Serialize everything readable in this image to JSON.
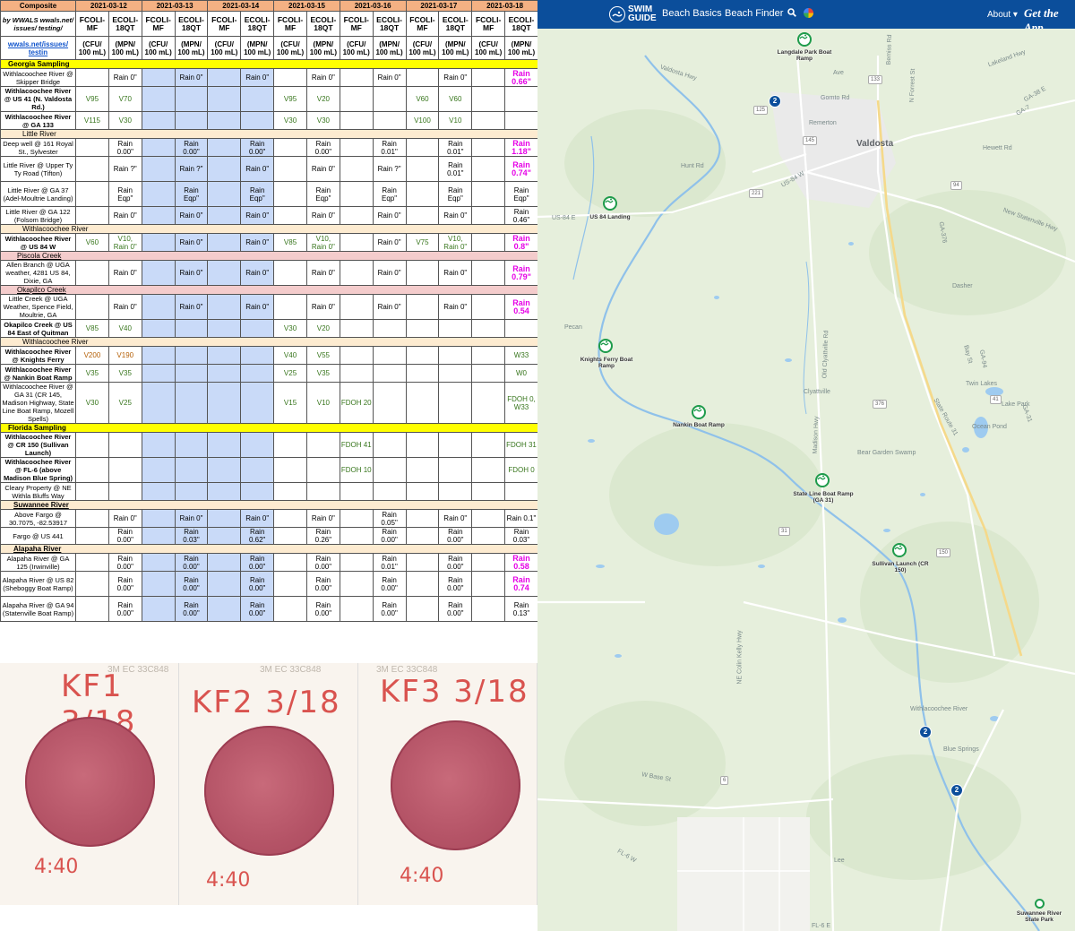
{
  "sheet": {
    "corner_title": "Composite",
    "corner_sub": "by WWALS wwals.net/ issues/ testing/",
    "url_link": "wwals.net/issues/ testin",
    "dates": [
      "2021-03-12",
      "2021-03-13",
      "2021-03-14",
      "2021-03-15",
      "2021-03-16",
      "2021-03-17",
      "2021-03-18"
    ],
    "params": [
      "FCOLI- MF",
      "ECOLI- 18QT"
    ],
    "units": [
      "(CFU/ 100 mL)",
      "(MPN/ 100 mL)"
    ],
    "rows": [
      {
        "type": "sec-y",
        "label": "Georgia Sampling"
      },
      {
        "type": "data",
        "loc": "Withlacoochee River @ Skipper Bridge",
        "bold": false,
        "cells": [
          "",
          "Rain 0\"",
          "",
          "Rain 0\"",
          "",
          "Rain 0\"",
          "",
          "Rain 0\"",
          "",
          "Rain 0\"",
          "",
          "Rain 0\"",
          "",
          "Rain 0.66\""
        ],
        "styles": [
          "",
          "",
          "",
          "",
          "",
          "",
          "",
          "",
          "",
          "",
          "",
          "",
          "",
          "mag"
        ]
      },
      {
        "type": "data",
        "loc": "Withlacoochee River @ US 41 (N. Valdosta Rd.)",
        "bold": true,
        "cells": [
          "V95",
          "V70",
          "",
          "",
          "",
          "",
          "V95",
          "V20",
          "",
          "",
          "V60",
          "V60",
          "",
          ""
        ],
        "styles": [
          "green",
          "green",
          "",
          "",
          "",
          "",
          "green",
          "green",
          "",
          "",
          "green",
          "green",
          "",
          ""
        ]
      },
      {
        "type": "data",
        "loc": "Withlacoochee River @ GA 133",
        "bold": true,
        "cells": [
          "V115",
          "V30",
          "",
          "",
          "",
          "",
          "V30",
          "V30",
          "",
          "",
          "V100",
          "V10",
          "",
          ""
        ],
        "styles": [
          "green",
          "green",
          "",
          "",
          "",
          "",
          "green",
          "green",
          "",
          "",
          "green",
          "green",
          "",
          ""
        ]
      },
      {
        "type": "sec-c",
        "label": "Little River"
      },
      {
        "type": "data",
        "loc": "Deep well @ 161 Royal St., Sylvester",
        "bold": false,
        "cells": [
          "",
          "Rain 0.00\"",
          "",
          "Rain 0.00\"",
          "",
          "Rain 0.00\"",
          "",
          "Rain 0.00\"",
          "",
          "Rain 0.01\"",
          "",
          "Rain 0.01\"",
          "",
          "Rain 1.18\""
        ],
        "styles": [
          "",
          "",
          "",
          "",
          "",
          "",
          "",
          "",
          "",
          "",
          "",
          "",
          "",
          "mag"
        ]
      },
      {
        "type": "data",
        "loc": "Little River @ Upper Ty Ty Road (Tifton)",
        "bold": false,
        "cells": [
          "",
          "Rain ?\"",
          "",
          "Rain ?\"",
          "",
          "Rain 0\"",
          "",
          "Rain 0\"",
          "",
          "Rain ?\"",
          "",
          "Rain 0.01\"",
          "",
          "Rain 0.74\""
        ],
        "styles": [
          "",
          "",
          "",
          "",
          "",
          "",
          "",
          "",
          "",
          "",
          "",
          "",
          "",
          "mag"
        ]
      },
      {
        "type": "data",
        "loc": "Little River @ GA 37 (Adel-Moultrie Landing)",
        "bold": false,
        "cells": [
          "",
          "Rain Eqp\"",
          "",
          "Rain Eqp\"",
          "",
          "Rain Eqp\"",
          "",
          "Rain Eqp\"",
          "",
          "Rain Eqp\"",
          "",
          "Rain Eqp\"",
          "",
          "Rain Eqp\""
        ],
        "styles": [
          "",
          "",
          "",
          "",
          "",
          "",
          "",
          "",
          "",
          "",
          "",
          "",
          "",
          ""
        ]
      },
      {
        "type": "data",
        "loc": "Little River @ GA 122 (Folsom Bridge)",
        "bold": false,
        "cells": [
          "",
          "Rain 0\"",
          "",
          "Rain 0\"",
          "",
          "Rain 0\"",
          "",
          "Rain 0\"",
          "",
          "Rain 0\"",
          "",
          "Rain 0\"",
          "",
          "Rain 0.46\""
        ],
        "styles": [
          "",
          "",
          "",
          "",
          "",
          "",
          "",
          "",
          "",
          "",
          "",
          "",
          "",
          ""
        ]
      },
      {
        "type": "sec-c",
        "label": "Withlacoochee River"
      },
      {
        "type": "data",
        "loc": "Withlacoochee River @ US 84 W",
        "bold": true,
        "cells": [
          "V60",
          "V10, Rain 0\"",
          "",
          "Rain 0\"",
          "",
          "Rain 0\"",
          "V85",
          "V10, Rain 0\"",
          "",
          "Rain 0\"",
          "V75",
          "V10, Rain 0\"",
          "",
          "Rain 0.8\""
        ],
        "styles": [
          "green",
          "green",
          "",
          "",
          "",
          "",
          "green",
          "green",
          "",
          "",
          "green",
          "green",
          "",
          "mag"
        ]
      },
      {
        "type": "sec-p",
        "label": "Piscola Creek"
      },
      {
        "type": "data",
        "loc": "Allen Branch @ UGA weather, 4281 US 84, Dixie, GA",
        "bold": false,
        "cells": [
          "",
          "Rain 0\"",
          "",
          "Rain 0\"",
          "",
          "Rain 0\"",
          "",
          "Rain 0\"",
          "",
          "Rain 0\"",
          "",
          "Rain 0\"",
          "",
          "Rain 0.79\""
        ],
        "styles": [
          "",
          "",
          "",
          "",
          "",
          "",
          "",
          "",
          "",
          "",
          "",
          "",
          "",
          "mag"
        ]
      },
      {
        "type": "sec-p",
        "label": "Okapilco Creek"
      },
      {
        "type": "data",
        "loc": "Little Creek @ UGA Weather, Spence Field, Moultrie, GA",
        "bold": false,
        "cells": [
          "",
          "Rain 0\"",
          "",
          "Rain 0\"",
          "",
          "Rain 0\"",
          "",
          "Rain 0\"",
          "",
          "Rain 0\"",
          "",
          "Rain 0\"",
          "",
          "Rain 0.54"
        ],
        "styles": [
          "",
          "",
          "",
          "",
          "",
          "",
          "",
          "",
          "",
          "",
          "",
          "",
          "",
          "mag"
        ]
      },
      {
        "type": "data",
        "loc": "Okapilco Creek @ US 84 East of Quitman",
        "bold": true,
        "cells": [
          "V85",
          "V40",
          "",
          "",
          "",
          "",
          "V30",
          "V20",
          "",
          "",
          "",
          "",
          "",
          ""
        ],
        "styles": [
          "green",
          "green",
          "",
          "",
          "",
          "",
          "green",
          "green",
          "",
          "",
          "",
          "",
          "",
          ""
        ]
      },
      {
        "type": "sec-c",
        "label": "Withlacoochee River"
      },
      {
        "type": "data",
        "loc": "Withlacoochee River @ Knights Ferry",
        "bold": true,
        "cells": [
          "V200",
          "V190",
          "",
          "",
          "",
          "",
          "V40",
          "V55",
          "",
          "",
          "",
          "",
          "",
          "W33"
        ],
        "styles": [
          "orange",
          "orange",
          "",
          "",
          "",
          "",
          "green",
          "green",
          "",
          "",
          "",
          "",
          "",
          "green"
        ]
      },
      {
        "type": "data",
        "loc": "Withlacoochee River @ Nankin Boat Ramp",
        "bold": true,
        "cells": [
          "V35",
          "V35",
          "",
          "",
          "",
          "",
          "V25",
          "V35",
          "",
          "",
          "",
          "",
          "",
          "W0"
        ],
        "styles": [
          "green",
          "green",
          "",
          "",
          "",
          "",
          "green",
          "green",
          "",
          "",
          "",
          "",
          "",
          "green"
        ]
      },
      {
        "type": "data",
        "loc": "Withlacoochee River @ GA 31 (CR 145, Madison Highway, State Line Boat Ramp, Mozell Spells)",
        "bold": false,
        "cells": [
          "V30",
          "V25",
          "",
          "",
          "",
          "",
          "V15",
          "V10",
          "FDOH 20",
          "",
          "",
          "",
          "",
          "FDOH 0, W33"
        ],
        "styles": [
          "green",
          "green",
          "",
          "",
          "",
          "",
          "green",
          "green",
          "fdoh",
          "",
          "",
          "",
          "",
          "fdoh"
        ]
      },
      {
        "type": "sec-y",
        "label": "Florida Sampling"
      },
      {
        "type": "data",
        "loc": "Withlacoochee River @ CR 150 (Sullivan Launch)",
        "bold": true,
        "cells": [
          "",
          "",
          "",
          "",
          "",
          "",
          "",
          "",
          "FDOH 41",
          "",
          "",
          "",
          "",
          "FDOH 31"
        ],
        "styles": [
          "",
          "",
          "",
          "",
          "",
          "",
          "",
          "",
          "fdoh",
          "",
          "",
          "",
          "",
          "fdoh"
        ]
      },
      {
        "type": "data",
        "loc": "Withlacoochee River @ FL-6 (above Madison Blue Spring)",
        "bold": true,
        "cells": [
          "",
          "",
          "",
          "",
          "",
          "",
          "",
          "",
          "FDOH 10",
          "",
          "",
          "",
          "",
          "FDOH 0"
        ],
        "styles": [
          "",
          "",
          "",
          "",
          "",
          "",
          "",
          "",
          "fdoh",
          "",
          "",
          "",
          "",
          "fdoh"
        ]
      },
      {
        "type": "data",
        "loc": "Cleary Property @ NE Withla Bluffs Way",
        "bold": false,
        "cells": [
          "",
          "",
          "",
          "",
          "",
          "",
          "",
          "",
          "",
          "",
          "",
          "",
          "",
          ""
        ],
        "styles": [
          "",
          "",
          "",
          "",
          "",
          "",
          "",
          "",
          "",
          "",
          "",
          "",
          "",
          ""
        ]
      },
      {
        "type": "sec-cb",
        "label": "Suwannee River"
      },
      {
        "type": "data",
        "loc": "Above Fargo @ 30.7075, -82.53917",
        "bold": false,
        "cells": [
          "",
          "Rain 0\"",
          "",
          "Rain 0\"",
          "",
          "Rain 0\"",
          "",
          "Rain 0\"",
          "",
          "Rain 0.05\"",
          "",
          "Rain 0\"",
          "",
          "Rain 0.1\""
        ],
        "styles": [
          "",
          "",
          "",
          "",
          "",
          "",
          "",
          "",
          "",
          "",
          "",
          "",
          "",
          ""
        ]
      },
      {
        "type": "data",
        "loc": "Fargo @ US 441",
        "bold": false,
        "cells": [
          "",
          "Rain 0.00\"",
          "",
          "Rain 0.03\"",
          "",
          "Rain 0.62\"",
          "",
          "Rain 0.26\"",
          "",
          "Rain 0.00\"",
          "",
          "Rain 0.00\"",
          "",
          "Rain 0.03\""
        ],
        "styles": [
          "",
          "",
          "",
          "",
          "",
          "",
          "",
          "",
          "",
          "",
          "",
          "",
          "",
          ""
        ]
      },
      {
        "type": "sec-cb",
        "label": "Alapaha River"
      },
      {
        "type": "data",
        "loc": "Alapaha River @ GA 125 (Irwinville)",
        "bold": false,
        "cells": [
          "",
          "Rain 0.00\"",
          "",
          "Rain 0.00\"",
          "",
          "Rain 0.00\"",
          "",
          "Rain 0.00\"",
          "",
          "Rain 0.01\"",
          "",
          "Rain 0.00\"",
          "",
          "Rain 0.58"
        ],
        "styles": [
          "",
          "",
          "",
          "",
          "",
          "",
          "",
          "",
          "",
          "",
          "",
          "",
          "",
          "mag"
        ]
      },
      {
        "type": "data",
        "loc": "Alapaha River @ US 82 (Sheboggy Boat Ramp)",
        "bold": false,
        "cells": [
          "",
          "Rain 0.00\"",
          "",
          "Rain 0.00\"",
          "",
          "Rain 0.00\"",
          "",
          "Rain 0.00\"",
          "",
          "Rain 0.00\"",
          "",
          "Rain 0.00\"",
          "",
          "Rain 0.74"
        ],
        "styles": [
          "",
          "",
          "",
          "",
          "",
          "",
          "",
          "",
          "",
          "",
          "",
          "",
          "",
          "mag"
        ]
      },
      {
        "type": "data",
        "loc": "Alapaha River @ GA 94 (Statenville Boat Ramp)",
        "bold": false,
        "cells": [
          "",
          "Rain 0.00\"",
          "",
          "Rain 0.00\"",
          "",
          "Rain 0.00\"",
          "",
          "Rain 0.00\"",
          "",
          "Rain 0.00\"",
          "",
          "Rain 0.00\"",
          "",
          "Rain 0.13\""
        ],
        "styles": [
          "",
          "",
          "",
          "",
          "",
          "",
          "",
          "",
          "",
          "",
          "",
          "",
          "",
          ""
        ]
      }
    ]
  },
  "photo": {
    "brand": "3M EC 33C848",
    "plates": [
      {
        "label": "KF1 3/18",
        "time": "4:40"
      },
      {
        "label": "KF2 3/18",
        "time": "4:40"
      },
      {
        "label": "KF3 3/18",
        "time": "4:40"
      }
    ]
  },
  "nav": {
    "brand_line1": "SWIM",
    "brand_line2": "GUIDE",
    "links": [
      "Beach Basics",
      "Beach Finder"
    ],
    "about": "About",
    "get_app": "Get the App",
    "accent": "#0b4e9b"
  },
  "map": {
    "cities": [
      "Valdosta",
      "Remerton",
      "Clyattville",
      "Dasher",
      "Twin Lakes",
      "Lake Park",
      "Lee",
      "Blue Springs"
    ],
    "places": [
      "Valdosta Hwy",
      "Gornto Rd",
      "US-84 E",
      "Madison Hwy",
      "Old Clyattville Rd",
      "NE Colin Kelly Hwy",
      "Withlacoochee River",
      "Ocean Pond",
      "Bear Garden Swamp",
      "Hewett Rd",
      "New Statenville Hwy",
      "US-84 W",
      "GA-38 E",
      "W Base St",
      "FL-6 W",
      "FL-6 E",
      "State Route 31",
      "Lakeland Hwy",
      "Bemiss Rd",
      "N Forrest St",
      "GA-7",
      "GA-31",
      "GA-376",
      "GA-94",
      "Bay St",
      "Hunt Rd",
      "Ave",
      "Pecan"
    ],
    "shields": [
      "125",
      "133",
      "221",
      "94",
      "376",
      "41",
      "31",
      "145",
      "150",
      "6"
    ],
    "markers": [
      {
        "name": "Langdale Park Boat Ramp"
      },
      {
        "name": "US 84 Landing"
      },
      {
        "name": "Knights Ferry Boat Ramp"
      },
      {
        "name": "Nankin Boat Ramp"
      },
      {
        "name": "State Line Boat Ramp (GA 31)"
      },
      {
        "name": "Sullivan Launch (CR 150)"
      },
      {
        "name": "Suwannee River State Park"
      }
    ],
    "clusters": [
      "2",
      "2",
      "2"
    ]
  }
}
